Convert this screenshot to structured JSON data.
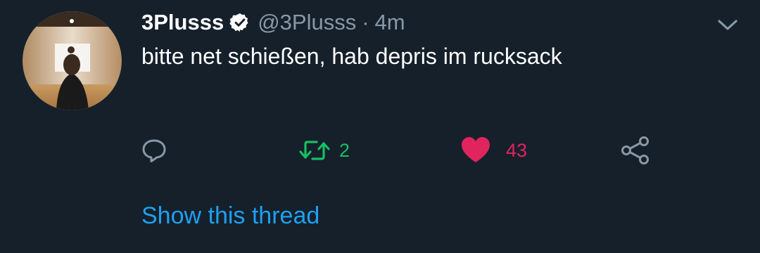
{
  "tweet": {
    "display_name": "3Plusss",
    "verified": true,
    "handle": "@3Plusss",
    "separator": "·",
    "time": "4m",
    "text": "bitte net schießen, hab depris im rucksack",
    "show_thread": "Show this thread"
  },
  "actions": {
    "reply": {
      "icon": "reply-icon"
    },
    "retweet": {
      "icon": "retweet-icon",
      "count": "2",
      "color": "#17bf63"
    },
    "like": {
      "icon": "heart-icon",
      "count": "43",
      "color": "#e0245e"
    },
    "share": {
      "icon": "share-icon"
    }
  },
  "colors": {
    "background": "#15202b",
    "muted": "#8899a6",
    "link": "#1da1f2"
  }
}
